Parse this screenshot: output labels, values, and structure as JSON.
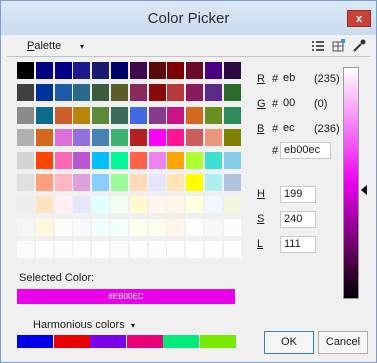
{
  "window": {
    "title": "Color Picker",
    "close_label": "x"
  },
  "toolbar": {
    "palette_prefix": "P",
    "palette_rest": "alette",
    "palette_arrow": "▾",
    "icons": [
      "list-icon",
      "grid-edit-icon",
      "eyedropper-icon"
    ]
  },
  "palette": {
    "rows": [
      [
        "#000000",
        "#000080",
        "#00008b",
        "#1a1a8a",
        "#191970",
        "#00006b",
        "#3d0b4d",
        "#5a0a0a",
        "#7f0000",
        "#6b0a28",
        "#4b0082",
        "#2a0a40",
        "#0b1a2a",
        "#000000",
        "#1a0a1a"
      ],
      [
        "#404040",
        "#003399",
        "#1e5aa8",
        "#2a6b8a",
        "#3d5c3d",
        "#5c5c2a",
        "#8a2a5c",
        "#8a0a0a",
        "#b83a3a",
        "#8b1a5c",
        "#5c2a8b",
        "#2a6b2a",
        "#4b6b2a",
        "#3a3a8a",
        "#6b6b6b"
      ],
      [
        "#8a8a8a",
        "#0a6b8a",
        "#cc5c2a",
        "#b8860b",
        "#5c8a3a",
        "#3a6b5c",
        "#4169e1",
        "#8a3a8a",
        "#c71585",
        "#d2691e",
        "#6b8e23",
        "#2e8b57",
        "#5f9ea0",
        "#8a5c2a",
        "#a9a9a9"
      ],
      [
        "#b0b0b0",
        "#d2691e",
        "#da70d6",
        "#9370db",
        "#4682b4",
        "#3cb371",
        "#b22222",
        "#ff00ff",
        "#ff1493",
        "#cd5c5c",
        "#e9967a",
        "#808000",
        "#20b2aa",
        "#d8bfd8",
        "#c0c0c0"
      ],
      [
        "#d3d3d3",
        "#ff4500",
        "#ff69b4",
        "#ba55d3",
        "#00bfff",
        "#00fa9a",
        "#ff6347",
        "#ee82ee",
        "#ffa500",
        "#adff2f",
        "#40e0d0",
        "#87ceeb",
        "#f0e68c",
        "#9932cc",
        "#dcdcdc"
      ],
      [
        "#e0e0e0",
        "#ffa07a",
        "#ffb6c1",
        "#dda0dd",
        "#87cefa",
        "#98fb98",
        "#ffdab9",
        "#e6e6fa",
        "#ffe4b5",
        "#ffff00",
        "#afeeee",
        "#b0c4de",
        "#fafad2",
        "#d8bfd8",
        "#e8e8e8"
      ],
      [
        "#eeeeee",
        "#ffe4c4",
        "#fff0f5",
        "#e6e6fa",
        "#e0ffff",
        "#f0fff0",
        "#fffacd",
        "#fff5ee",
        "#fdf5e6",
        "#ffffe0",
        "#f0f8ff",
        "#f5f5dc",
        "#faf0e6",
        "#f5fffa",
        "#f5f5f5"
      ],
      [
        "#f5f5f5",
        "#fff8dc",
        "#fffafa",
        "#f8f8ff",
        "#f0ffff",
        "#f5fffa",
        "#fffff0",
        "#fffaf0",
        "#fff5ee",
        "#fefefe",
        "#f7f7f7",
        "#fcfcfc",
        "#fafafa",
        "#fbfbfb",
        "#ffffff"
      ],
      [
        "#fafafa",
        "#fdfdfd",
        "#fcfcfc",
        "#fefefe",
        "#ffffff",
        "#fbfbfb",
        "#fdfdfd",
        "#fcfcfc",
        "#fefefe",
        "#ffffff",
        "#fdfdfd",
        "#fefefe",
        "#ffffff",
        "#fcfcfc",
        "#ffffff"
      ]
    ]
  },
  "selected": {
    "label": "Selected Color:",
    "hex_text": "#EB00EC",
    "color": "#eb00ec"
  },
  "harmonious": {
    "label": "Harmonious colors",
    "arrow": "▾",
    "colors": [
      "#0000eb",
      "#eb0000",
      "#7c00eb",
      "#eb007c",
      "#00eb7c",
      "#76eb00"
    ]
  },
  "rgb": {
    "r": {
      "letter": "R",
      "hex": "eb",
      "dec": "(235)"
    },
    "g": {
      "letter": "G",
      "hex": "00",
      "dec": "(0)"
    },
    "b": {
      "letter": "B",
      "hex": "ec",
      "dec": "(236)"
    },
    "full_hex": "eb00ec"
  },
  "hsl": {
    "h": {
      "letter": "H",
      "value": "199"
    },
    "s": {
      "letter": "S",
      "value": "240"
    },
    "l": {
      "letter": "L",
      "value": "111"
    }
  },
  "hash_symbol": "#",
  "buttons": {
    "ok": "OK",
    "cancel": "Cancel"
  }
}
